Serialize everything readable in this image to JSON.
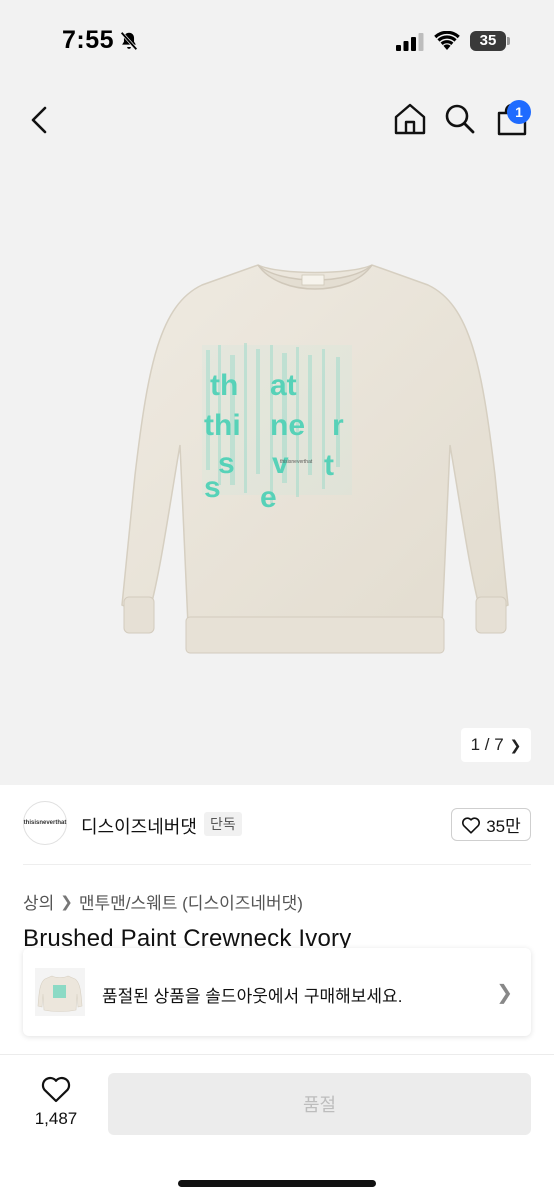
{
  "status_bar": {
    "time": "7:55",
    "battery": "35"
  },
  "header": {
    "cart_count": "1"
  },
  "gallery": {
    "pager_text": "1 / 7"
  },
  "brand": {
    "logo_text": "thisisneverthat",
    "name": "디스이즈네버댓",
    "tag": "단독",
    "likes": "35만"
  },
  "breadcrumb": {
    "items": [
      "상의",
      "맨투맨/스웨트 (디스이즈네버댓)"
    ]
  },
  "product": {
    "title": "Brushed Paint Crewneck Ivory"
  },
  "soldout_banner": {
    "text": "품절된 상품을 솔드아웃에서 구매해보세요."
  },
  "bottom_bar": {
    "wish_count": "1,487",
    "action_label": "품절"
  },
  "colors": {
    "accent_badge": "#1f6bff",
    "print_mint": "#3ecfb3",
    "sweatshirt": "#ece6dc",
    "background": "#f2f2f2"
  }
}
